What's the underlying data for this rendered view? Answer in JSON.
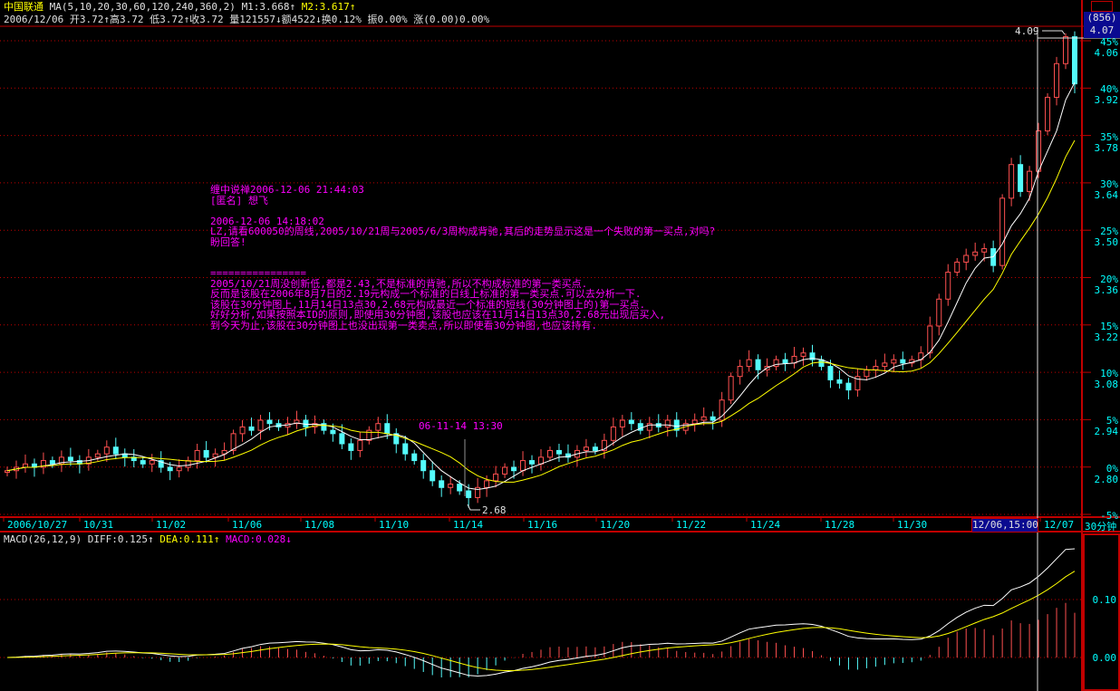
{
  "header": {
    "stock_name": "中国联通",
    "ma_params": "MA(5,10,20,30,60,120,240,360,2)",
    "m1": "M1:3.668↑",
    "m2": "M2:3.617↑",
    "quote_line": "2006/12/06 开3.72↑高3.72 低3.72↑收3.72 量121557↓额4522↓换0.12% 振0.00% 涨(0.00)0.00%"
  },
  "side_panel": {
    "tab_icon": "grid-icon",
    "count": "(856)",
    "price": "4.07"
  },
  "annotation": {
    "lines": [
      "缠中说禅2006-12-06 21:44:03",
      "[匿名] 想飞",
      "",
      "2006-12-06 14:18:02",
      "LZ,请看600050的周线,2005/10/21周与2005/6/3周构成背驰,其后的走势显示这是一个失败的第一买点,对吗?",
      "盼回答!",
      "",
      "",
      "================",
      "2005/10/21周没创新低,都是2.43,不是标准的背驰,所以不构成标准的第一类买点.",
      "反而是该股在2006年8月7日的2.19元构成一个标准的日线上标准的第一类买点.可以去分析一下.",
      "该股在30分钟图上,11月14日13点30,2.68元构成最近一个标准的短线(30分钟图上的)第一买点.",
      "好好分析,如果按照本ID的原则,即使用30分钟图,该股也应该在11月14日13点30,2.68元出现后买入,",
      "到今天为止,该股在30分钟图上也没出现第一类卖点,所以即使看30分钟图,也应该持有."
    ]
  },
  "markers": {
    "high_label": "4.09",
    "low_label": "2.68",
    "low_time_label": "06-11-14  13:30"
  },
  "macd_header": {
    "params": "MACD(26,12,9)",
    "diff": "DIFF:0.125↑",
    "dea": "DEA:0.111↑",
    "macd": "MACD:0.028↓"
  },
  "period_label": "30分钟",
  "cursor_date": "12/06,15:00",
  "colors": {
    "up": "#ff5050",
    "down": "#54fcfc",
    "ma5": "#ffffff",
    "ma10": "#ffff00",
    "grid": "#c00000",
    "axis": "#00ffff",
    "note": "#ff00ff"
  },
  "chart_data": {
    "type": "candlestick",
    "base_price": 2.8,
    "y_ticks": [
      {
        "pct": "45%",
        "price": "4.06"
      },
      {
        "pct": "40%",
        "price": "3.92"
      },
      {
        "pct": "35%",
        "price": "3.78"
      },
      {
        "pct": "30%",
        "price": "3.64"
      },
      {
        "pct": "25%",
        "price": "3.50"
      },
      {
        "pct": "20%",
        "price": "3.36"
      },
      {
        "pct": "15%",
        "price": "3.22"
      },
      {
        "pct": "10%",
        "price": "3.08"
      },
      {
        "pct": "5%",
        "price": "2.94"
      },
      {
        "pct": "0%",
        "price": "2.80"
      },
      {
        "pct": "-5%",
        "price": ""
      }
    ],
    "x_labels": [
      "2006/10/27",
      "10/31",
      "11/02",
      "11/06",
      "11/08",
      "11/10",
      "11/14",
      "11/16",
      "11/20",
      "11/22",
      "11/24",
      "11/28",
      "11/30",
      "12/07"
    ],
    "macd_ticks": [
      "0.10",
      "0.00"
    ],
    "closes": [
      2.79,
      2.8,
      2.81,
      2.8,
      2.82,
      2.81,
      2.83,
      2.82,
      2.81,
      2.83,
      2.84,
      2.86,
      2.84,
      2.83,
      2.82,
      2.81,
      2.82,
      2.8,
      2.79,
      2.8,
      2.82,
      2.85,
      2.83,
      2.84,
      2.85,
      2.9,
      2.92,
      2.91,
      2.94,
      2.93,
      2.92,
      2.93,
      2.94,
      2.92,
      2.93,
      2.91,
      2.9,
      2.87,
      2.85,
      2.88,
      2.91,
      2.93,
      2.9,
      2.87,
      2.84,
      2.82,
      2.79,
      2.76,
      2.74,
      2.75,
      2.73,
      2.71,
      2.74,
      2.76,
      2.78,
      2.8,
      2.79,
      2.82,
      2.81,
      2.83,
      2.85,
      2.84,
      2.83,
      2.85,
      2.86,
      2.85,
      2.88,
      2.92,
      2.94,
      2.93,
      2.91,
      2.93,
      2.92,
      2.94,
      2.91,
      2.93,
      2.94,
      2.95,
      2.94,
      3.0,
      3.07,
      3.1,
      3.12,
      3.09,
      3.1,
      3.12,
      3.11,
      3.13,
      3.14,
      3.12,
      3.1,
      3.06,
      3.05,
      3.03,
      3.07,
      3.09,
      3.1,
      3.11,
      3.12,
      3.11,
      3.12,
      3.14,
      3.22,
      3.3,
      3.38,
      3.41,
      3.43,
      3.44,
      3.45,
      3.4,
      3.6,
      3.7,
      3.62,
      3.68,
      3.8,
      3.9,
      4.0,
      4.08,
      3.94
    ],
    "high": 4.09,
    "low": 2.68
  }
}
